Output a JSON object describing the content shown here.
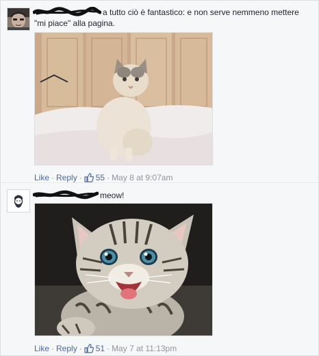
{
  "comments": [
    {
      "author_name": "",
      "text": "a tutto ciò è fantastico: e non serve nemmeno mettere \"mi piace\" alla pagina.",
      "image_icon": "cat-photo",
      "actions": {
        "like_label": "Like",
        "reply_label": "Reply",
        "like_count": "55",
        "timestamp": "May 8 at 9:07am"
      }
    },
    {
      "author_name": "",
      "text": "meow!",
      "image_icon": "kitten-photo",
      "actions": {
        "like_label": "Like",
        "reply_label": "Reply",
        "like_count": "51",
        "timestamp": "May 7 at 11:13pm"
      }
    }
  ],
  "colors": {
    "link": "#4b67a1",
    "meta": "#90949c",
    "background": "#f6f7f9",
    "redaction": "#111111"
  },
  "icons": {
    "like": "thumbs-up-icon",
    "avatar1": "user-avatar-icon",
    "avatar2": "user-avatar-icon"
  }
}
